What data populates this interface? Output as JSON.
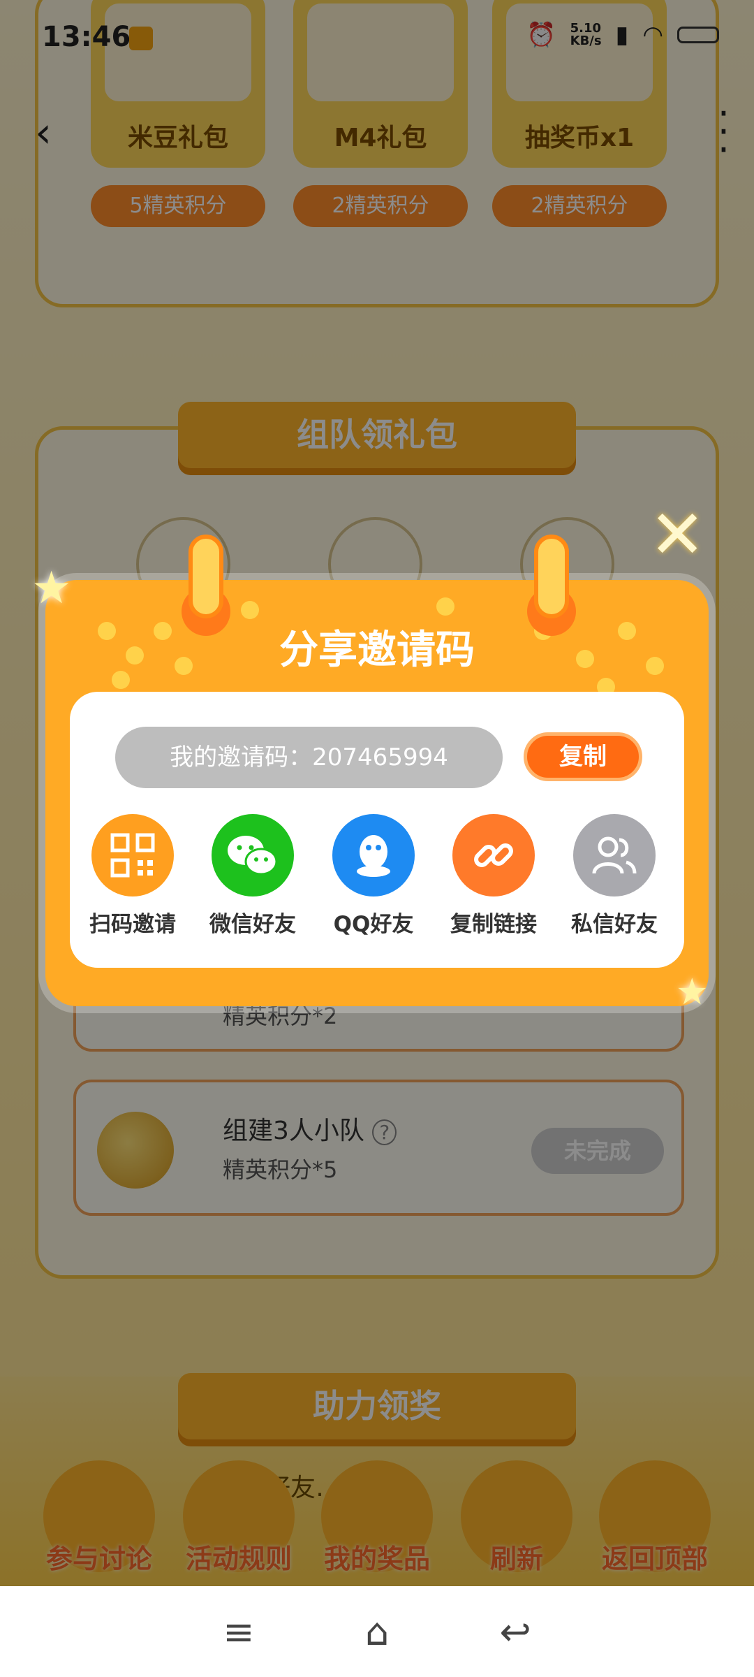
{
  "status_bar": {
    "time": "13:46",
    "speed": "5.10\nKB/s"
  },
  "top_gifts": [
    {
      "name": "米豆礼包",
      "price": "5精英积分"
    },
    {
      "name": "M4礼包",
      "price": "2精英积分"
    },
    {
      "name": "抽奖币x1",
      "price": "2精英积分"
    }
  ],
  "team_section": {
    "title": "组队领礼包",
    "task_partial_sub": "精英积分*2",
    "task": {
      "title": "组建3人小队",
      "sub": "精英积分*5",
      "state": "未完成"
    }
  },
  "help_section": {
    "title": "助力领奖",
    "text": "好友…邀请"
  },
  "bottom_bar": [
    {
      "label": "参与讨论"
    },
    {
      "label": "活动规则"
    },
    {
      "label": "我的奖品"
    },
    {
      "label": "刷新"
    },
    {
      "label": "返回顶部"
    }
  ],
  "modal": {
    "title": "分享邀请码",
    "code_text": "我的邀请码：207465994",
    "copy_label": "复制",
    "share_options": [
      {
        "label": "扫码邀请",
        "icon": "qr-code-icon",
        "color": "#ff9f1f"
      },
      {
        "label": "微信好友",
        "icon": "wechat-icon",
        "color": "#1dc11d"
      },
      {
        "label": "QQ好友",
        "icon": "qq-icon",
        "color": "#1e8bf2"
      },
      {
        "label": "复制链接",
        "icon": "link-icon",
        "color": "#ff7a2a"
      },
      {
        "label": "私信好友",
        "icon": "friends-icon",
        "color": "#a9a9ae"
      }
    ]
  },
  "colors": {
    "accent": "#ffaa25",
    "overlay": "rgba(0,0,0,0.45)"
  }
}
